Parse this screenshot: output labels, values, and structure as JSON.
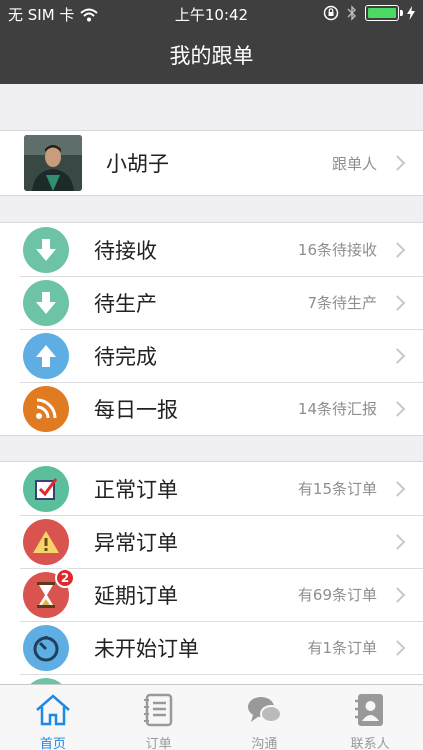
{
  "status_bar": {
    "carrier": "无 SIM 卡",
    "time": "上午10:42"
  },
  "nav": {
    "title": "我的跟单"
  },
  "profile": {
    "name": "小胡子",
    "role": "跟单人"
  },
  "group1": [
    {
      "label": "待接收",
      "detail": "16条待接收",
      "icon": "arrow-down-icon",
      "color": "#6cc3a5"
    },
    {
      "label": "待生产",
      "detail": "7条待生产",
      "icon": "arrow-down-icon",
      "color": "#6cc3a5"
    },
    {
      "label": "待完成",
      "detail": "",
      "icon": "arrow-up-icon",
      "color": "#5faee3"
    },
    {
      "label": "每日一报",
      "detail": "14条待汇报",
      "icon": "rss-icon",
      "color": "#e07b22"
    }
  ],
  "group2": [
    {
      "label": "正常订单",
      "detail": "有15条订单",
      "icon": "checkbox-icon",
      "color": "#5bbf9b"
    },
    {
      "label": "异常订单",
      "detail": "",
      "icon": "warning-icon",
      "color": "#d9534f"
    },
    {
      "label": "延期订单",
      "detail": "有69条订单",
      "icon": "hourglass-icon",
      "color": "#d9534f",
      "badge": "2"
    },
    {
      "label": "未开始订单",
      "detail": "有1条订单",
      "icon": "timer-icon",
      "color": "#5faee3"
    }
  ],
  "tabs": [
    {
      "label": "首页",
      "icon": "home-icon",
      "active": true
    },
    {
      "label": "订单",
      "icon": "order-list-icon",
      "active": false
    },
    {
      "label": "沟通",
      "icon": "chat-icon",
      "active": false
    },
    {
      "label": "联系人",
      "icon": "contacts-icon",
      "active": false
    }
  ],
  "colors": {
    "bar": "#3f3f3f",
    "accent": "#1e88e5",
    "background": "#efeff4"
  }
}
